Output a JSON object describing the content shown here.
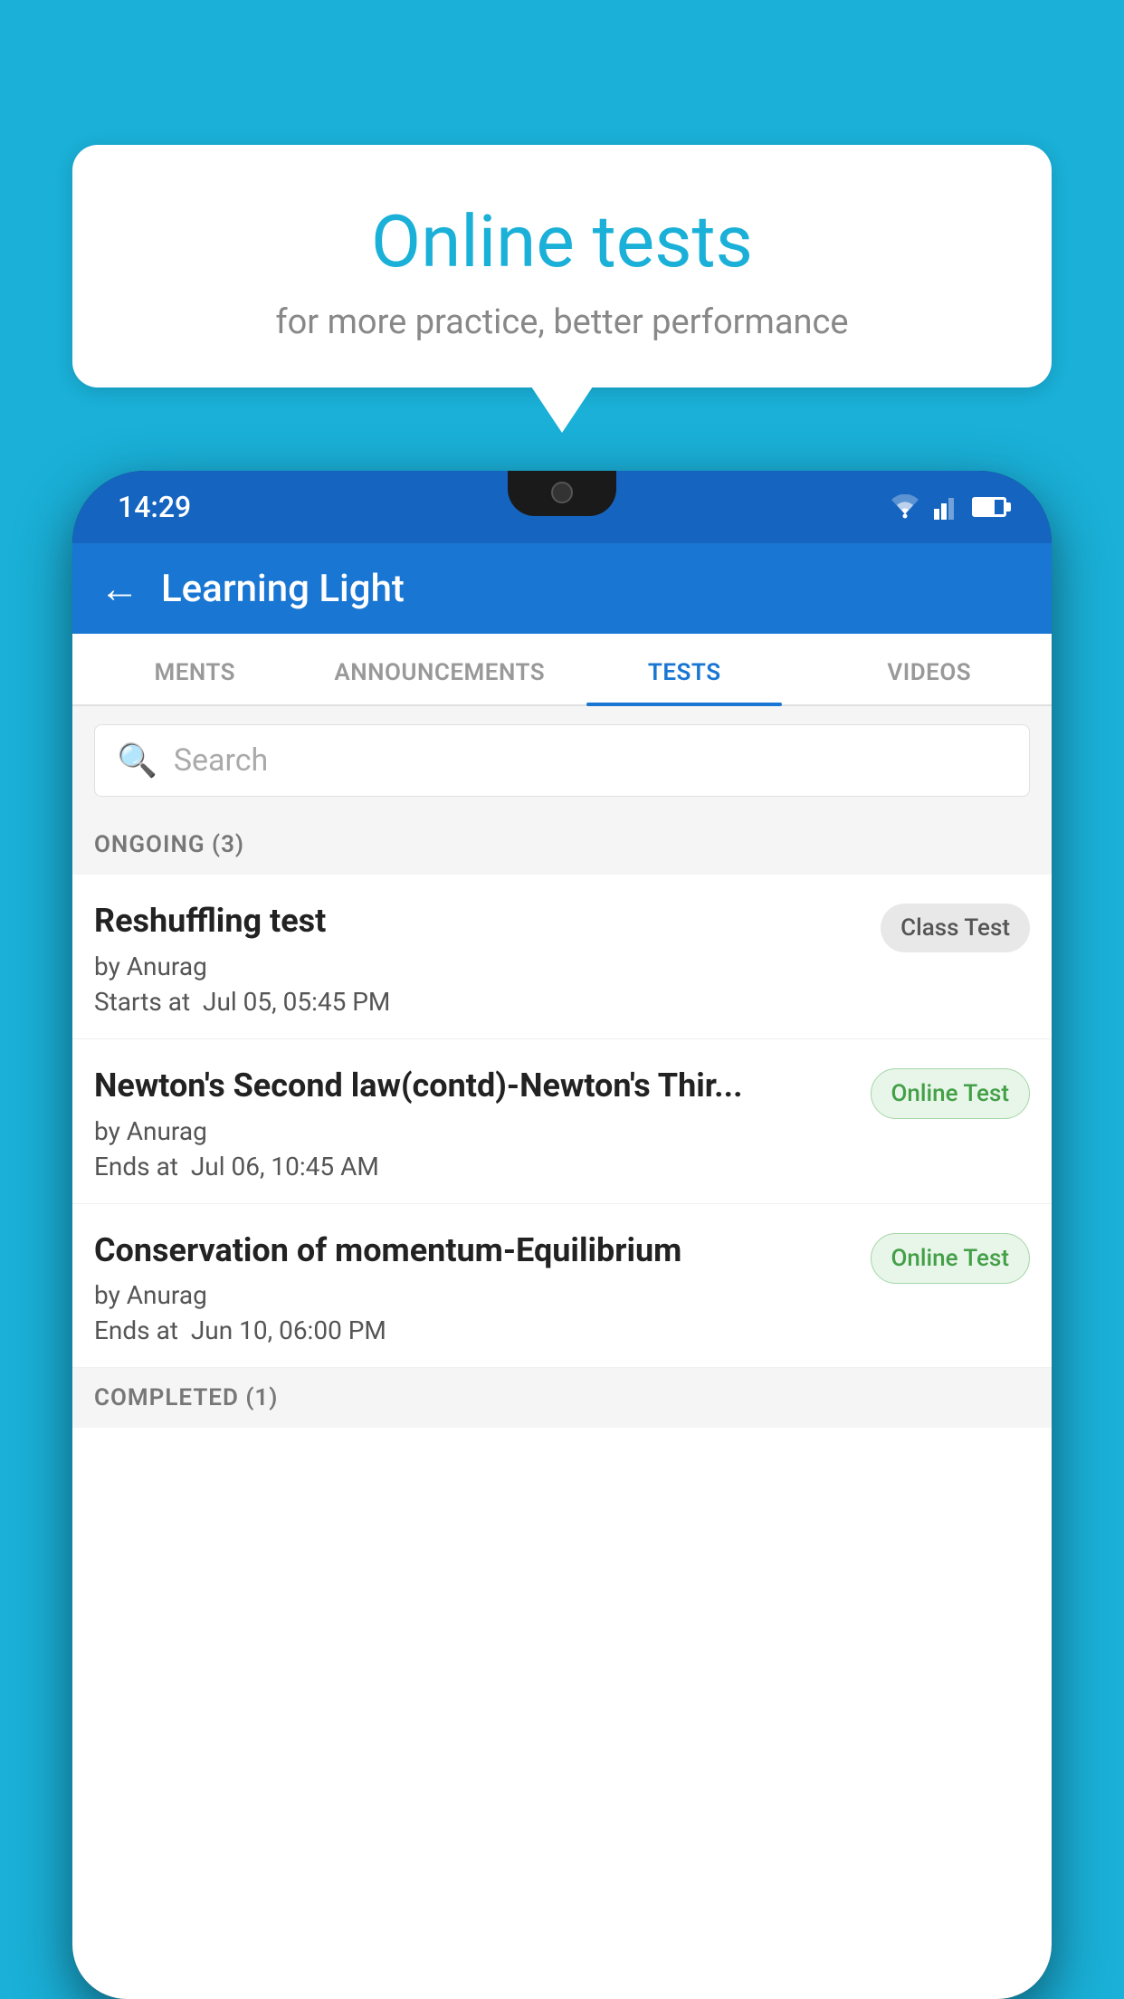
{
  "background_color": "#1ab0d8",
  "bubble": {
    "title": "Online tests",
    "subtitle": "for more practice, better performance"
  },
  "phone": {
    "status_bar": {
      "time": "14:29"
    },
    "app_bar": {
      "back_label": "←",
      "title": "Learning Light"
    },
    "tabs": [
      {
        "label": "MENTS",
        "active": false
      },
      {
        "label": "ANNOUNCEMENTS",
        "active": false
      },
      {
        "label": "TESTS",
        "active": true
      },
      {
        "label": "VIDEOS",
        "active": false
      }
    ],
    "search": {
      "placeholder": "Search"
    },
    "ongoing_section": {
      "header": "ONGOING (3)",
      "tests": [
        {
          "name": "Reshuffling test",
          "author": "by Anurag",
          "time_label": "Starts at",
          "time": "Jul 05, 05:45 PM",
          "badge": "Class Test",
          "badge_type": "class"
        },
        {
          "name": "Newton's Second law(contd)-Newton's Thir...",
          "author": "by Anurag",
          "time_label": "Ends at",
          "time": "Jul 06, 10:45 AM",
          "badge": "Online Test",
          "badge_type": "online"
        },
        {
          "name": "Conservation of momentum-Equilibrium",
          "author": "by Anurag",
          "time_label": "Ends at",
          "time": "Jun 10, 06:00 PM",
          "badge": "Online Test",
          "badge_type": "online"
        }
      ]
    },
    "completed_section": {
      "header": "COMPLETED (1)"
    }
  }
}
